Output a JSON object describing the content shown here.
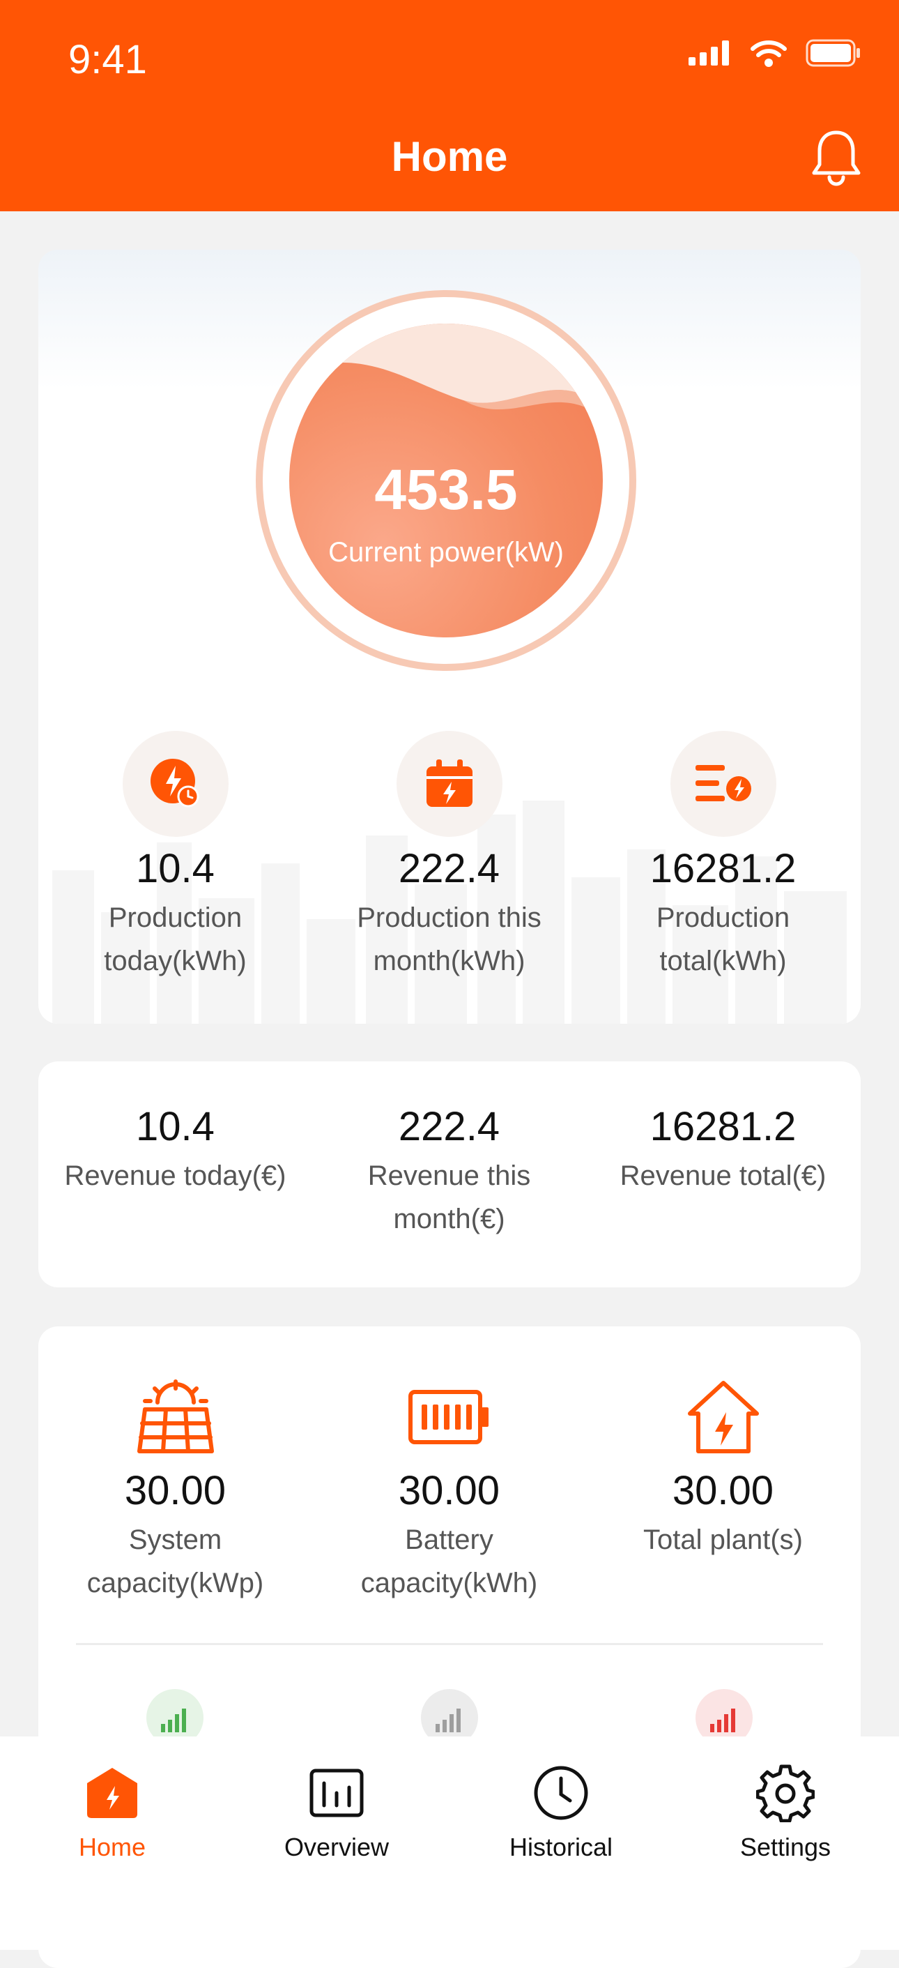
{
  "status_bar": {
    "time": "9:41"
  },
  "header": {
    "title": "Home"
  },
  "power": {
    "value": "453.5",
    "label": "Current power(kW)"
  },
  "production": [
    {
      "value": "10.4",
      "label_line1": "Production",
      "label_line2": "today(kWh)",
      "icon": "lightning-clock-icon"
    },
    {
      "value": "222.4",
      "label_line1": "Production this",
      "label_line2": "month(kWh)",
      "icon": "calendar-lightning-icon"
    },
    {
      "value": "16281.2",
      "label_line1": "Production",
      "label_line2": "total(kWh)",
      "icon": "stack-lightning-icon"
    }
  ],
  "revenue": [
    {
      "value": "10.4",
      "label_line1": "Revenue today(€)",
      "label_line2": ""
    },
    {
      "value": "222.4",
      "label_line1": "Revenue this",
      "label_line2": "month(€)"
    },
    {
      "value": "16281.2",
      "label_line1": "Revenue total(€)",
      "label_line2": ""
    }
  ],
  "capacity": [
    {
      "value": "30.00",
      "label_line1": "System",
      "label_line2": "capacity(kWp)",
      "icon": "solar-panel-icon"
    },
    {
      "value": "30.00",
      "label_line1": "Battery",
      "label_line2": "capacity(kWh)",
      "icon": "battery-icon"
    },
    {
      "value": "30.00",
      "label_line1": "Total plant(s)",
      "label_line2": "",
      "icon": "house-lightning-icon"
    }
  ],
  "signals": [
    {
      "icon": "signal-green-icon",
      "color": "#4caf50"
    },
    {
      "icon": "signal-gray-icon",
      "color": "#9e9e9e"
    },
    {
      "icon": "signal-red-icon",
      "color": "#e53935"
    }
  ],
  "tabs": [
    {
      "label": "Home",
      "active": true
    },
    {
      "label": "Overview",
      "active": false
    },
    {
      "label": "Historical",
      "active": false
    },
    {
      "label": "Settings",
      "active": false
    }
  ],
  "colors": {
    "accent": "#ff5505",
    "orb": "#f58c63"
  }
}
